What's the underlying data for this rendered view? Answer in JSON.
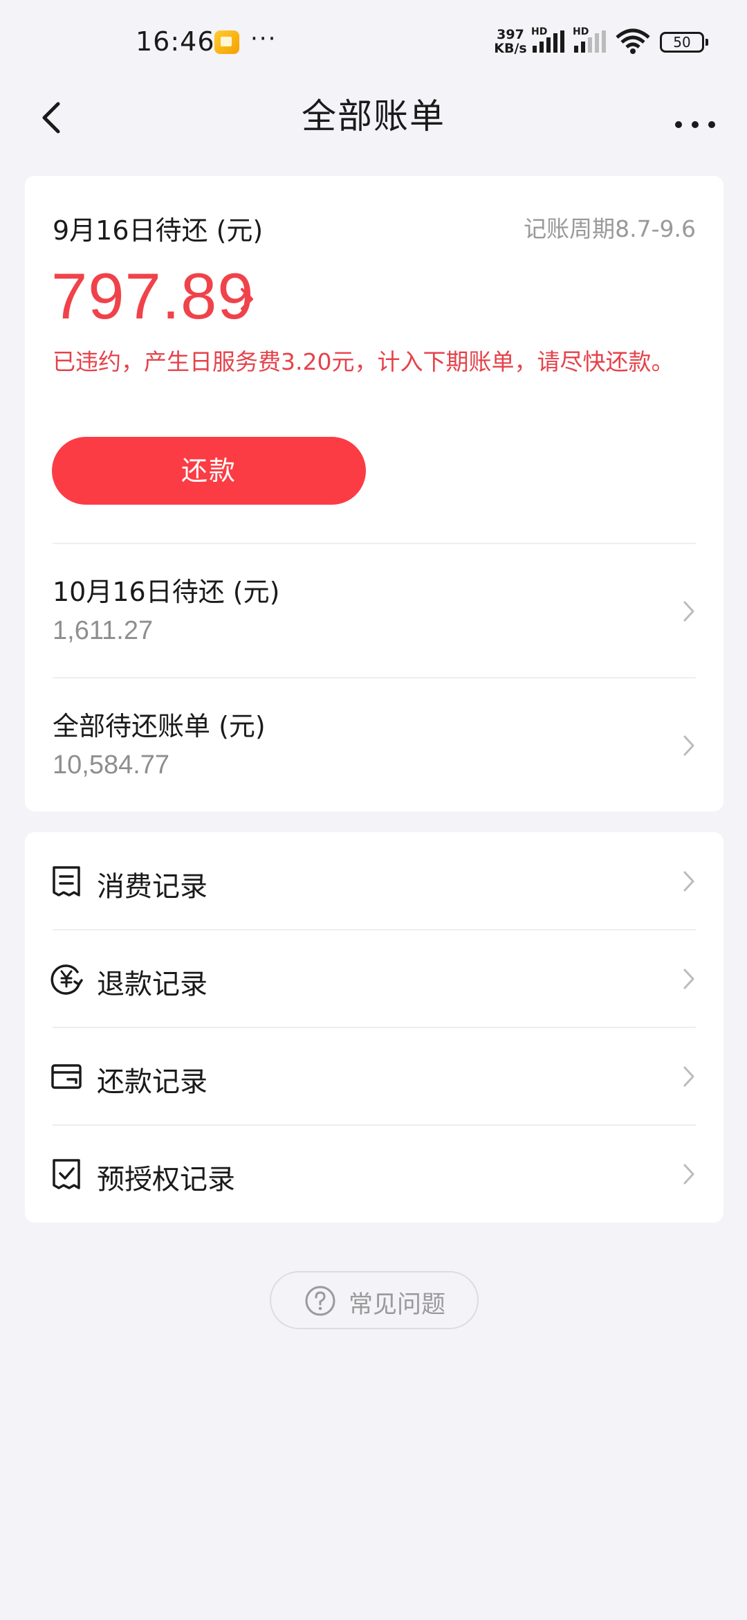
{
  "status_bar": {
    "time": "16:46",
    "dots": "···",
    "speed_value": "397",
    "speed_unit": "KB/s",
    "hd1": "HD",
    "hd2": "HD",
    "battery": "50"
  },
  "nav": {
    "title": "全部账单"
  },
  "bill": {
    "due_label": "9月16日待还 (元)",
    "period": "记账周期8.7-9.6",
    "amount": "797.89",
    "warning": "已违约，产生日服务费3.20元，计入下期账单，请尽快还款。",
    "pay_button": "还款",
    "rows": [
      {
        "label": "10月16日待还 (元)",
        "value": "1,611.27"
      },
      {
        "label": "全部待还账单 (元)",
        "value": "10,584.77"
      }
    ]
  },
  "records": [
    {
      "label": "消费记录",
      "icon": "receipt-icon"
    },
    {
      "label": "退款记录",
      "icon": "refund-yen-icon"
    },
    {
      "label": "还款记录",
      "icon": "wallet-icon"
    },
    {
      "label": "预授权记录",
      "icon": "checked-receipt-icon"
    }
  ],
  "faq": {
    "label": "常见问题"
  },
  "colors": {
    "accent_red": "#fb3c44",
    "amount_red": "#f0424a",
    "background": "#f3f3f8"
  }
}
